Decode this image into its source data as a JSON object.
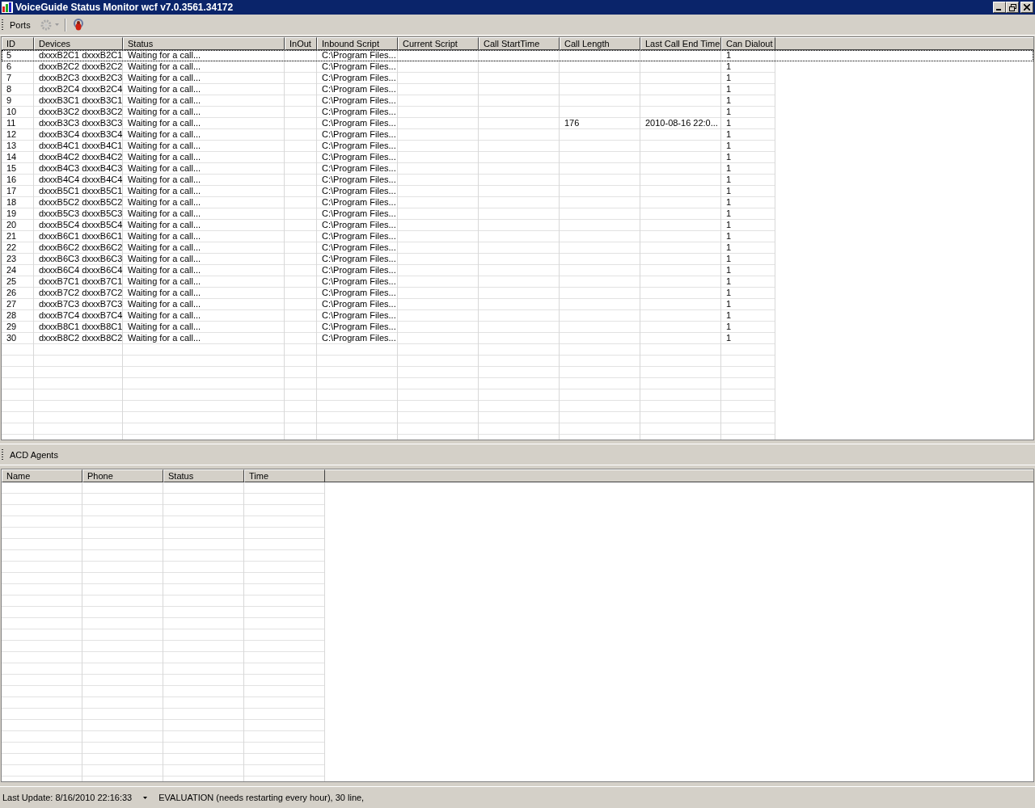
{
  "window": {
    "title": "VoiceGuide Status Monitor wcf v7.0.3561.34172"
  },
  "toolbar": {
    "label": "Ports",
    "buttons": [
      {
        "kind": "gear",
        "disabled": true,
        "dropdown": true
      },
      {
        "kind": "bug",
        "disabled": false,
        "dropdown": false
      }
    ]
  },
  "ports_table": {
    "columns": [
      "ID",
      "Devices",
      "Status",
      "InOut",
      "Inbound Script",
      "Current Script",
      "Call StartTime",
      "Call Length",
      "Last Call End Time",
      "Can Dialout"
    ],
    "rows": [
      {
        "cells": [
          "5",
          "dxxxB2C1 dxxxB2C1",
          "Waiting for a call...",
          null,
          "C:\\Program Files...",
          null,
          null,
          null,
          null,
          "1"
        ],
        "selected": true
      },
      {
        "cells": [
          "6",
          "dxxxB2C2 dxxxB2C2",
          "Waiting for a call...",
          null,
          "C:\\Program Files...",
          null,
          null,
          null,
          null,
          "1"
        ],
        "selected": false
      },
      {
        "cells": [
          "7",
          "dxxxB2C3 dxxxB2C3",
          "Waiting for a call...",
          null,
          "C:\\Program Files...",
          null,
          null,
          null,
          null,
          "1"
        ],
        "selected": false
      },
      {
        "cells": [
          "8",
          "dxxxB2C4 dxxxB2C4",
          "Waiting for a call...",
          null,
          "C:\\Program Files...",
          null,
          null,
          null,
          null,
          "1"
        ],
        "selected": false
      },
      {
        "cells": [
          "9",
          "dxxxB3C1 dxxxB3C1",
          "Waiting for a call...",
          null,
          "C:\\Program Files...",
          null,
          null,
          null,
          null,
          "1"
        ],
        "selected": false
      },
      {
        "cells": [
          "10",
          "dxxxB3C2 dxxxB3C2",
          "Waiting for a call...",
          null,
          "C:\\Program Files...",
          null,
          null,
          null,
          null,
          "1"
        ],
        "selected": false
      },
      {
        "cells": [
          "11",
          "dxxxB3C3 dxxxB3C3",
          "Waiting for a call...",
          null,
          "C:\\Program Files...",
          null,
          null,
          "176",
          "2010-08-16 22:0...",
          "1"
        ],
        "selected": false
      },
      {
        "cells": [
          "12",
          "dxxxB3C4 dxxxB3C4",
          "Waiting for a call...",
          null,
          "C:\\Program Files...",
          null,
          null,
          null,
          null,
          "1"
        ],
        "selected": false
      },
      {
        "cells": [
          "13",
          "dxxxB4C1 dxxxB4C1",
          "Waiting for a call...",
          null,
          "C:\\Program Files...",
          null,
          null,
          null,
          null,
          "1"
        ],
        "selected": false
      },
      {
        "cells": [
          "14",
          "dxxxB4C2 dxxxB4C2",
          "Waiting for a call...",
          null,
          "C:\\Program Files...",
          null,
          null,
          null,
          null,
          "1"
        ],
        "selected": false
      },
      {
        "cells": [
          "15",
          "dxxxB4C3 dxxxB4C3",
          "Waiting for a call...",
          null,
          "C:\\Program Files...",
          null,
          null,
          null,
          null,
          "1"
        ],
        "selected": false
      },
      {
        "cells": [
          "16",
          "dxxxB4C4 dxxxB4C4",
          "Waiting for a call...",
          null,
          "C:\\Program Files...",
          null,
          null,
          null,
          null,
          "1"
        ],
        "selected": false
      },
      {
        "cells": [
          "17",
          "dxxxB5C1 dxxxB5C1",
          "Waiting for a call...",
          null,
          "C:\\Program Files...",
          null,
          null,
          null,
          null,
          "1"
        ],
        "selected": false
      },
      {
        "cells": [
          "18",
          "dxxxB5C2 dxxxB5C2",
          "Waiting for a call...",
          null,
          "C:\\Program Files...",
          null,
          null,
          null,
          null,
          "1"
        ],
        "selected": false
      },
      {
        "cells": [
          "19",
          "dxxxB5C3 dxxxB5C3",
          "Waiting for a call...",
          null,
          "C:\\Program Files...",
          null,
          null,
          null,
          null,
          "1"
        ],
        "selected": false
      },
      {
        "cells": [
          "20",
          "dxxxB5C4 dxxxB5C4",
          "Waiting for a call...",
          null,
          "C:\\Program Files...",
          null,
          null,
          null,
          null,
          "1"
        ],
        "selected": false
      },
      {
        "cells": [
          "21",
          "dxxxB6C1 dxxxB6C1",
          "Waiting for a call...",
          null,
          "C:\\Program Files...",
          null,
          null,
          null,
          null,
          "1"
        ],
        "selected": false
      },
      {
        "cells": [
          "22",
          "dxxxB6C2 dxxxB6C2",
          "Waiting for a call...",
          null,
          "C:\\Program Files...",
          null,
          null,
          null,
          null,
          "1"
        ],
        "selected": false
      },
      {
        "cells": [
          "23",
          "dxxxB6C3 dxxxB6C3",
          "Waiting for a call...",
          null,
          "C:\\Program Files...",
          null,
          null,
          null,
          null,
          "1"
        ],
        "selected": false
      },
      {
        "cells": [
          "24",
          "dxxxB6C4 dxxxB6C4",
          "Waiting for a call...",
          null,
          "C:\\Program Files...",
          null,
          null,
          null,
          null,
          "1"
        ],
        "selected": false
      },
      {
        "cells": [
          "25",
          "dxxxB7C1 dxxxB7C1",
          "Waiting for a call...",
          null,
          "C:\\Program Files...",
          null,
          null,
          null,
          null,
          "1"
        ],
        "selected": false
      },
      {
        "cells": [
          "26",
          "dxxxB7C2 dxxxB7C2",
          "Waiting for a call...",
          null,
          "C:\\Program Files...",
          null,
          null,
          null,
          null,
          "1"
        ],
        "selected": false
      },
      {
        "cells": [
          "27",
          "dxxxB7C3 dxxxB7C3",
          "Waiting for a call...",
          null,
          "C:\\Program Files...",
          null,
          null,
          null,
          null,
          "1"
        ],
        "selected": false
      },
      {
        "cells": [
          "28",
          "dxxxB7C4 dxxxB7C4",
          "Waiting for a call...",
          null,
          "C:\\Program Files...",
          null,
          null,
          null,
          null,
          "1"
        ],
        "selected": false
      },
      {
        "cells": [
          "29",
          "dxxxB8C1 dxxxB8C1",
          "Waiting for a call...",
          null,
          "C:\\Program Files...",
          null,
          null,
          null,
          null,
          "1"
        ],
        "selected": false
      },
      {
        "cells": [
          "30",
          "dxxxB8C2 dxxxB8C2",
          "Waiting for a call...",
          null,
          "C:\\Program Files...",
          null,
          null,
          null,
          null,
          "1"
        ],
        "selected": false
      }
    ]
  },
  "agents_toolbar": {
    "label": "ACD Agents"
  },
  "agents_table": {
    "columns": [
      "Name",
      "Phone",
      "Status",
      "Time"
    ]
  },
  "status_bar": {
    "last_update": "Last Update: 8/16/2010 22:16:33",
    "message": "EVALUATION (needs restarting every hour), 30 line,"
  }
}
